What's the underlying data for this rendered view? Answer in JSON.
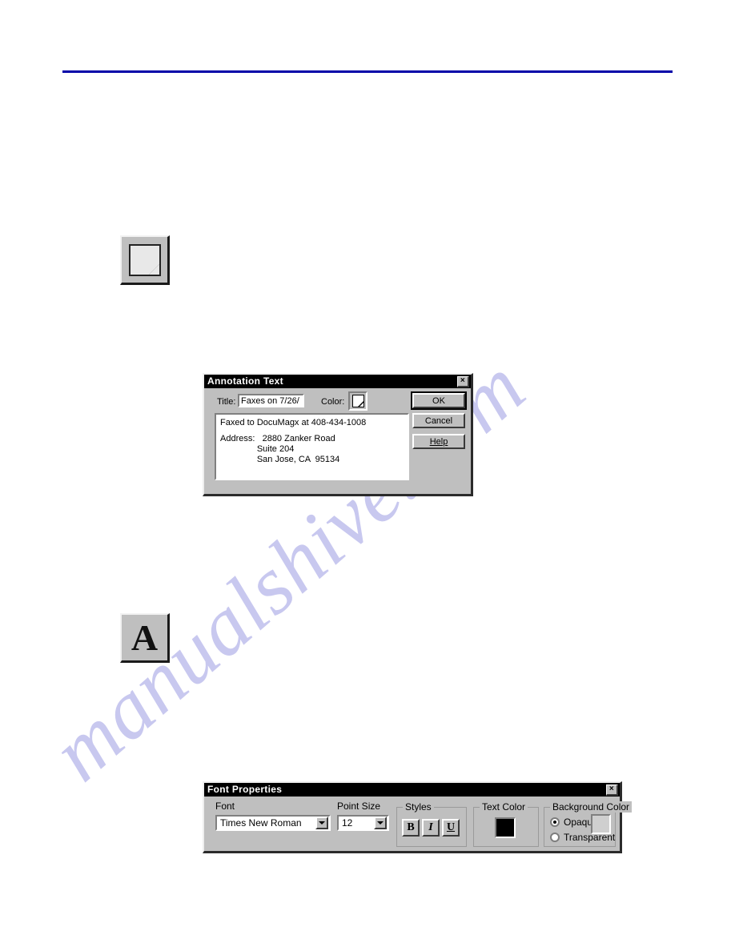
{
  "page": {
    "background_color": "#ffffff",
    "header_rule_color": "#0000a8"
  },
  "watermark": {
    "text": "manualshive.com",
    "color": "#c8c8ef"
  },
  "toolbar": {
    "annotation_tool": {
      "name": "annotation-note-tool",
      "icon": "note-page-icon"
    },
    "text_tool": {
      "name": "text-tool",
      "icon": "letter-a-icon",
      "glyph": "A"
    }
  },
  "annotation_dialog": {
    "title": "Annotation Text",
    "close_label": "×",
    "title_field": {
      "label": "Title:",
      "value": "Faxes on 7/26/"
    },
    "color_field": {
      "label": "Color:",
      "swatch_icon": "page-fold-icon"
    },
    "body_lines": [
      "Faxed to DocuMagx at 408-434-1008",
      "",
      "Address:   2880 Zanker Road",
      "               Suite 204",
      "               San Jose, CA  95134"
    ],
    "buttons": {
      "ok": "OK",
      "cancel": "Cancel",
      "help": "Help"
    }
  },
  "font_dialog": {
    "title": "Font Properties",
    "close_label": "×",
    "font": {
      "label": "Font",
      "value": "Times New Roman"
    },
    "point_size": {
      "label": "Point Size",
      "value": "12"
    },
    "styles": {
      "label": "Styles",
      "bold": "B",
      "italic": "I",
      "underline": "U"
    },
    "text_color": {
      "label": "Text Color",
      "value": "#000000"
    },
    "background_color": {
      "label": "Background Color",
      "opaque_label": "Opaque",
      "transparent_label": "Transparent",
      "selected": "Opaque",
      "swatch_value": "#cfcfcf"
    }
  }
}
